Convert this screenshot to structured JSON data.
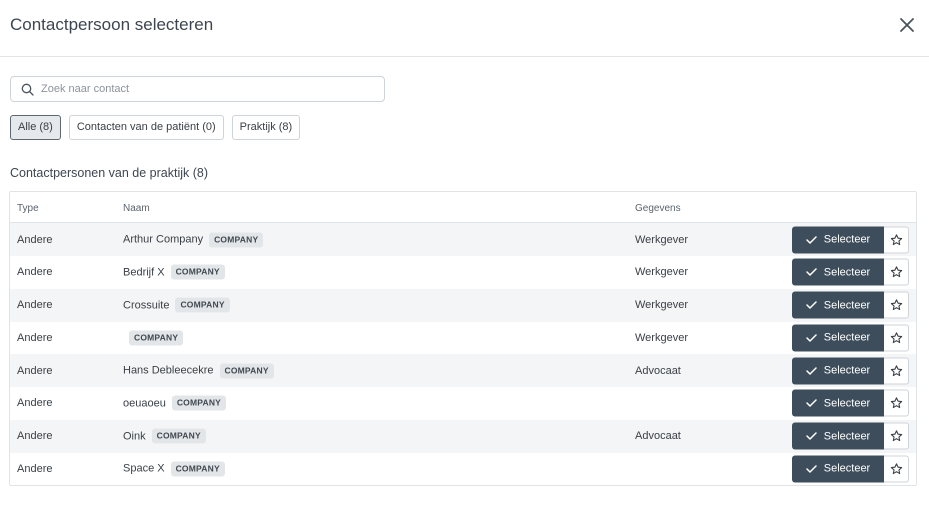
{
  "modal": {
    "title": "Contactpersoon selecteren"
  },
  "search": {
    "placeholder": "Zoek naar contact",
    "value": ""
  },
  "filters": [
    {
      "label": "Alle (8)",
      "active": true
    },
    {
      "label": "Contacten van de patiënt (0)",
      "active": false
    },
    {
      "label": "Praktijk (8)",
      "active": false
    }
  ],
  "section_title": "Contactpersonen van de praktijk (8)",
  "table": {
    "headers": {
      "type": "Type",
      "name": "Naam",
      "info": "Gegevens"
    },
    "select_label": "Selecteer",
    "rows": [
      {
        "type": "Andere",
        "name": "Arthur Company",
        "badge": "COMPANY",
        "info": "Werkgever"
      },
      {
        "type": "Andere",
        "name": "Bedrijf X",
        "badge": "COMPANY",
        "info": "Werkgever"
      },
      {
        "type": "Andere",
        "name": "Crossuite",
        "badge": "COMPANY",
        "info": "Werkgever"
      },
      {
        "type": "Andere",
        "name": "",
        "badge": "COMPANY",
        "info": "Werkgever"
      },
      {
        "type": "Andere",
        "name": "Hans Debleecekre",
        "badge": "COMPANY",
        "info": "Advocaat"
      },
      {
        "type": "Andere",
        "name": "oeuaoeu",
        "badge": "COMPANY",
        "info": ""
      },
      {
        "type": "Andere",
        "name": "Oink",
        "badge": "COMPANY",
        "info": "Advocaat"
      },
      {
        "type": "Andere",
        "name": "Space X",
        "badge": "COMPANY",
        "info": ""
      }
    ]
  },
  "icons": {
    "close": "close-icon",
    "search": "search-icon",
    "check": "check-icon",
    "star": "star-outline-icon"
  },
  "colors": {
    "primary_button": "#3e4d5c",
    "active_chip_bg": "#e6e9ec",
    "badge_bg": "#e3e6e9",
    "row_stripe": "#f4f5f6"
  }
}
